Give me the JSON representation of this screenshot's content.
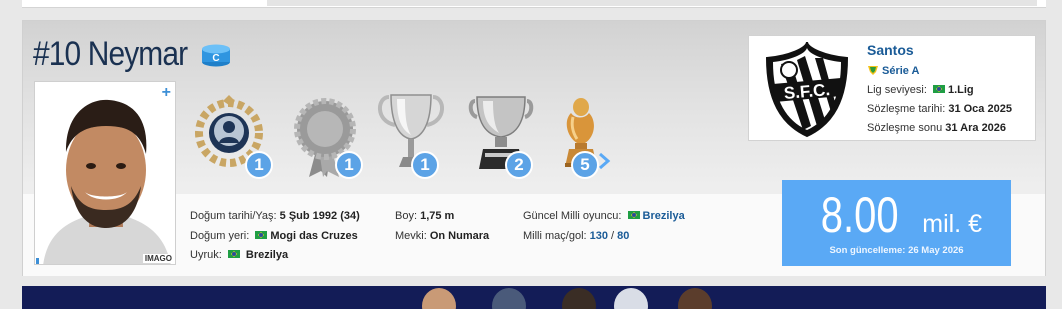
{
  "player": {
    "title": "#10 Neymar",
    "captain_badge": "C",
    "photo_credit": "IMAGO",
    "photo_add": "+"
  },
  "trophies": [
    {
      "icon": "player-of-year-wreath-icon",
      "count": "1"
    },
    {
      "icon": "medal-icon",
      "count": "1"
    },
    {
      "icon": "champions-league-trophy-icon",
      "count": "1"
    },
    {
      "icon": "league-trophy-icon",
      "count": "2"
    },
    {
      "icon": "golden-trophy-icon",
      "count": "5"
    }
  ],
  "info": {
    "birth_label": "Doğum tarihi/Yaş:",
    "birth_value": "5 Şub 1992 (34)",
    "birthplace_label": "Doğum yeri:",
    "birthplace_value": "Mogi das Cruzes",
    "nationality_label": "Uyruk:",
    "nationality_value": "Brezilya",
    "height_label": "Boy:",
    "height_value": "1,75 m",
    "position_label": "Mevki:",
    "position_value": "On Numara",
    "national_label": "Güncel Milli oyuncu:",
    "national_value": "Brezilya",
    "caps_label": "Milli maç/gol:",
    "caps_value": "130",
    "caps_separator": " / ",
    "goals_value": "80"
  },
  "club": {
    "name": "Santos",
    "league": "Série A",
    "level_label": "Lig seviyesi:",
    "level_value": "1.Lig",
    "contract_start_label": "Sözleşme tarihi:",
    "contract_start_value": "31 Oca 2025",
    "contract_end_label": "Sözleşme sonu",
    "contract_end_value": "31 Ara 2026"
  },
  "market_value": {
    "amount": "8.00",
    "unit": "mil. €",
    "updated": "Son güncelleme: 26 May 2026"
  },
  "colors": {
    "accent": "#5aa9f5",
    "title": "#1a3151",
    "link": "#1a5b97",
    "badge": "#5ca3e6"
  }
}
